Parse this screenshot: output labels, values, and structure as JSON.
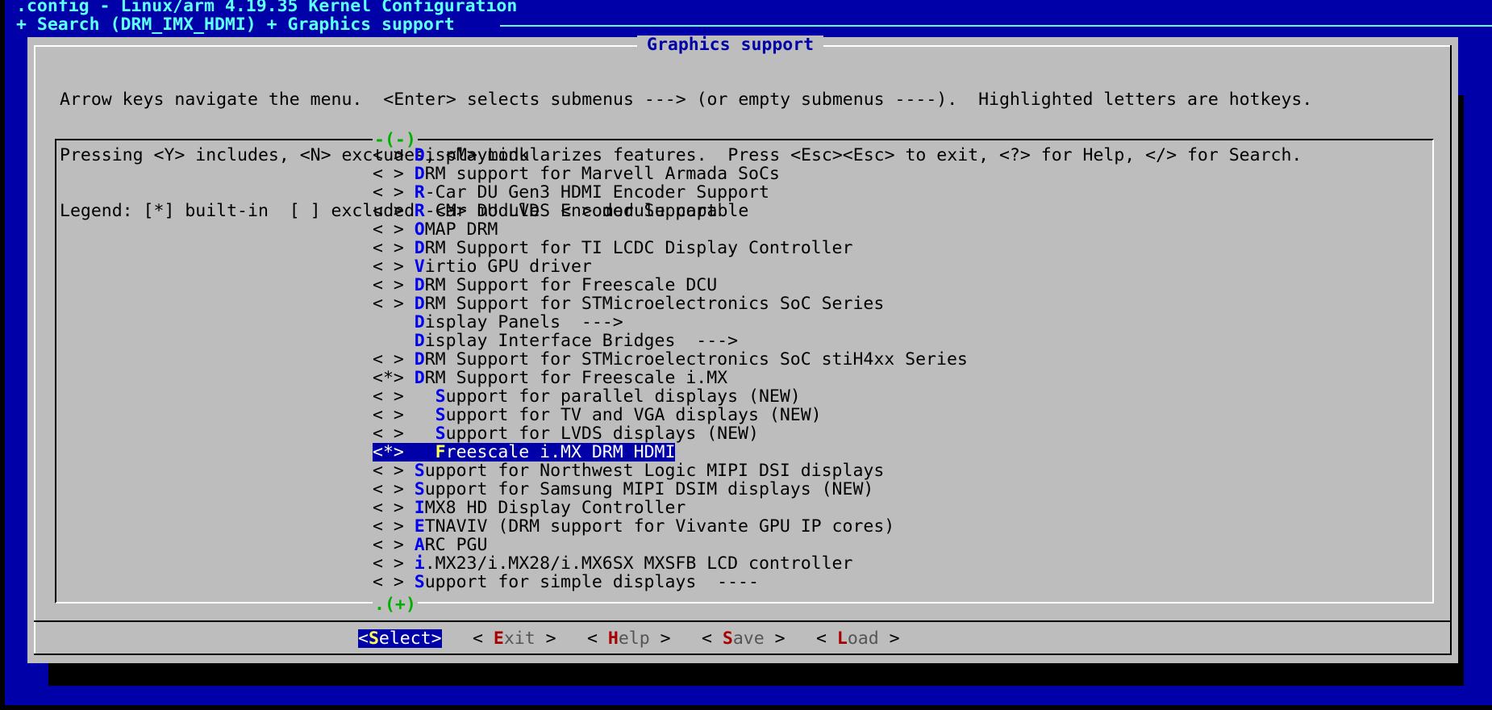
{
  "header": {
    "line1": ".config - Linux/arm 4.19.35 Kernel Configuration",
    "line2": "+ Search (DRM_IMX_HDMI) + Graphics support "
  },
  "dialog": {
    "title": "Graphics support",
    "help": [
      "Arrow keys navigate the menu.  <Enter> selects submenus ---> (or empty submenus ----).  Highlighted letters are hotkeys.",
      "Pressing <Y> includes, <N> excludes, <M> modularizes features.  Press <Esc><Esc> to exit, <?> for Help, </> for Search.",
      "Legend: [*] built-in  [ ] excluded  <M> module  < > module capable"
    ],
    "scroll_top": "-(-)",
    "scroll_bottom": ".(+)"
  },
  "menu_items": [
    {
      "prefix": "< > ",
      "hotkey": "D",
      "rest": "isplayLink"
    },
    {
      "prefix": "< > ",
      "hotkey": "D",
      "rest": "RM support for Marvell Armada SoCs"
    },
    {
      "prefix": "< > ",
      "hotkey": "R",
      "rest": "-Car DU Gen3 HDMI Encoder Support"
    },
    {
      "prefix": "< > ",
      "hotkey": "R",
      "rest": "-Car DU LVDS Encoder Support"
    },
    {
      "prefix": "< > ",
      "hotkey": "O",
      "rest": "MAP DRM"
    },
    {
      "prefix": "< > ",
      "hotkey": "D",
      "rest": "RM Support for TI LCDC Display Controller"
    },
    {
      "prefix": "< > ",
      "hotkey": "V",
      "rest": "irtio GPU driver"
    },
    {
      "prefix": "< > ",
      "hotkey": "D",
      "rest": "RM Support for Freescale DCU"
    },
    {
      "prefix": "< > ",
      "hotkey": "D",
      "rest": "RM Support for STMicroelectronics SoC Series"
    },
    {
      "prefix": "    ",
      "hotkey": "D",
      "rest": "isplay Panels  --->"
    },
    {
      "prefix": "    ",
      "hotkey": "D",
      "rest": "isplay Interface Bridges  --->"
    },
    {
      "prefix": "< > ",
      "hotkey": "D",
      "rest": "RM Support for STMicroelectronics SoC stiH4xx Series"
    },
    {
      "prefix": "<*> ",
      "hotkey": "D",
      "rest": "RM Support for Freescale i.MX"
    },
    {
      "prefix": "< >   ",
      "hotkey": "S",
      "rest": "upport for parallel displays (NEW)"
    },
    {
      "prefix": "< >   ",
      "hotkey": "S",
      "rest": "upport for TV and VGA displays (NEW)"
    },
    {
      "prefix": "< >   ",
      "hotkey": "S",
      "rest": "upport for LVDS displays (NEW)"
    },
    {
      "prefix": "<*>   ",
      "hotkey": "F",
      "rest": "reescale i.MX DRM HDMI",
      "selected": true
    },
    {
      "prefix": "< > ",
      "hotkey": "S",
      "rest": "upport for Northwest Logic MIPI DSI displays"
    },
    {
      "prefix": "< > ",
      "hotkey": "S",
      "rest": "upport for Samsung MIPI DSIM displays (NEW)"
    },
    {
      "prefix": "< > ",
      "hotkey": "I",
      "rest": "MX8 HD Display Controller"
    },
    {
      "prefix": "< > ",
      "hotkey": "E",
      "rest": "TNAVIV (DRM support for Vivante GPU IP cores)"
    },
    {
      "prefix": "< > ",
      "hotkey": "A",
      "rest": "RC PGU"
    },
    {
      "prefix": "< > ",
      "hotkey": "i",
      "rest": ".MX23/i.MX28/i.MX6SX MXSFB LCD controller"
    },
    {
      "prefix": "< > ",
      "hotkey": "S",
      "rest": "upport for simple displays  ----"
    }
  ],
  "buttons": [
    {
      "pre": "<",
      "hotkey": "S",
      "rest": "elect",
      "post": ">",
      "active": true
    },
    {
      "pre": "< ",
      "hotkey": "E",
      "rest": "xit",
      "post": " >"
    },
    {
      "pre": "< ",
      "hotkey": "H",
      "rest": "elp",
      "post": " >"
    },
    {
      "pre": "< ",
      "hotkey": "S",
      "rest": "ave",
      "post": " >"
    },
    {
      "pre": "< ",
      "hotkey": "L",
      "rest": "oad",
      "post": " >"
    }
  ]
}
